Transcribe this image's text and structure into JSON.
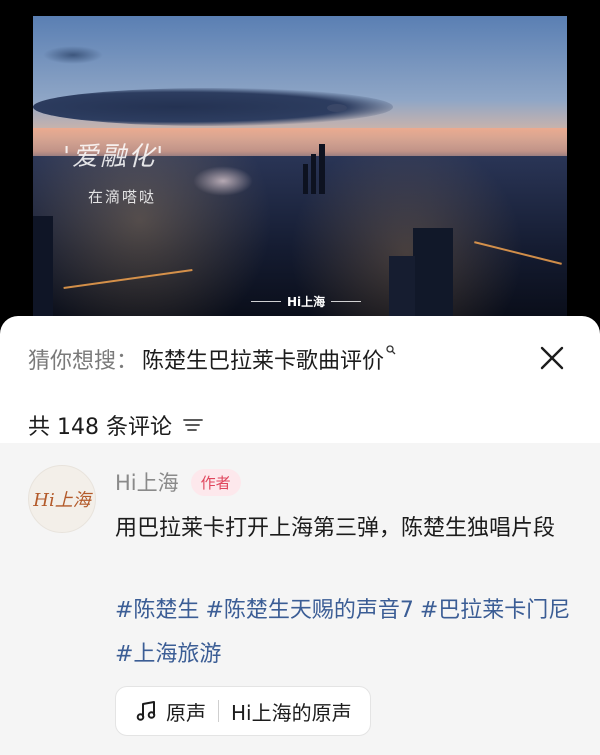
{
  "video": {
    "overlay_title": "'爱融化'",
    "overlay_subtitle": "在滴嗒哒",
    "watermark": "Hi上海"
  },
  "suggest": {
    "prefix": "猜你想搜：",
    "query": "陈楚生巴拉莱卡歌曲评价",
    "search_icon": "search-icon",
    "close_icon": "close-icon"
  },
  "comments_header": {
    "count_text": "共 148 条评论",
    "sort_icon": "sort-icon"
  },
  "comment": {
    "avatar_text": "Hi上海",
    "author": "Hi上海",
    "badge": "作者",
    "text": "用巴拉莱卡打开上海第三弹，陈楚生独唱片段",
    "tags": [
      "#陈楚生",
      "#陈楚生天赐的声音7",
      "#巴拉莱卡门尼",
      "#上海旅游"
    ],
    "music_label": "原声",
    "music_source": "Hi上海的原声",
    "music_icon": "music-note-icon"
  },
  "colors": {
    "tag_blue": "#3b5d95",
    "badge_red": "#e0455c",
    "badge_bg": "#fde8ec"
  }
}
